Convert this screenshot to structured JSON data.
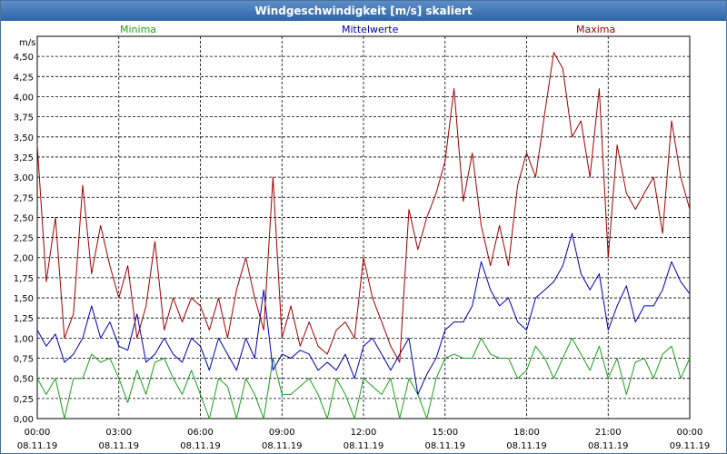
{
  "window": {
    "title": "Windgeschwindigkeit [m/s] skaliert"
  },
  "colors": {
    "min": "#1e9e1e",
    "mean": "#0000b4",
    "max": "#a00000",
    "grid": "#000000"
  },
  "chart_data": {
    "type": "line",
    "title": "Windgeschwindigkeit [m/s] skaliert",
    "ylabel": "m/s",
    "ylim": [
      0,
      4.75
    ],
    "yticks": [
      "0,00",
      "0,25",
      "0,50",
      "0,75",
      "1,00",
      "1,25",
      "1,50",
      "1,75",
      "2,00",
      "2,25",
      "2,50",
      "2,75",
      "3,00",
      "3,25",
      "3,50",
      "3,75",
      "4,00",
      "4,25",
      "4,50"
    ],
    "xlim_hours": [
      0,
      24
    ],
    "grid": true,
    "legend_position": "top",
    "xticks": [
      {
        "time": "00:00",
        "date": "08.11.19"
      },
      {
        "time": "03:00",
        "date": "08.11.19"
      },
      {
        "time": "06:00",
        "date": "08.11.19"
      },
      {
        "time": "09:00",
        "date": "08.11.19"
      },
      {
        "time": "12:00",
        "date": "08.11.19"
      },
      {
        "time": "15:00",
        "date": "08.11.19"
      },
      {
        "time": "18:00",
        "date": "08.11.19"
      },
      {
        "time": "21:00",
        "date": "08.11.19"
      },
      {
        "time": "00:00",
        "date": "09.11.19"
      }
    ],
    "series": [
      {
        "name": "Minima",
        "color": "#1e9e1e",
        "x": [
          0.0,
          0.33,
          0.67,
          1.0,
          1.33,
          1.67,
          2.0,
          2.33,
          2.67,
          3.0,
          3.33,
          3.67,
          4.0,
          4.33,
          4.67,
          5.0,
          5.33,
          5.67,
          6.0,
          6.33,
          6.67,
          7.0,
          7.33,
          7.67,
          8.0,
          8.33,
          8.67,
          9.0,
          9.33,
          9.67,
          10.0,
          10.33,
          10.67,
          11.0,
          11.33,
          11.67,
          12.0,
          12.33,
          12.67,
          13.0,
          13.33,
          13.67,
          14.0,
          14.33,
          14.67,
          15.0,
          15.33,
          15.67,
          16.0,
          16.33,
          16.67,
          17.0,
          17.33,
          17.67,
          18.0,
          18.33,
          18.67,
          19.0,
          19.33,
          19.67,
          20.0,
          20.33,
          20.67,
          21.0,
          21.33,
          21.67,
          22.0,
          22.33,
          22.67,
          23.0,
          23.33,
          23.67,
          24.0
        ],
        "values": [
          0.5,
          0.3,
          0.5,
          0.0,
          0.5,
          0.5,
          0.8,
          0.7,
          0.75,
          0.5,
          0.2,
          0.6,
          0.3,
          0.7,
          0.75,
          0.5,
          0.3,
          0.6,
          0.3,
          0.0,
          0.5,
          0.4,
          0.0,
          0.5,
          0.3,
          0.0,
          0.75,
          0.3,
          0.3,
          0.4,
          0.5,
          0.3,
          0.0,
          0.5,
          0.3,
          0.0,
          0.5,
          0.4,
          0.3,
          0.5,
          0.0,
          0.5,
          0.3,
          0.0,
          0.5,
          0.75,
          0.8,
          0.75,
          0.75,
          1.0,
          0.8,
          0.75,
          0.75,
          0.5,
          0.6,
          0.9,
          0.75,
          0.5,
          0.75,
          1.0,
          0.8,
          0.6,
          0.9,
          0.5,
          0.75,
          0.3,
          0.7,
          0.75,
          0.5,
          0.8,
          0.9,
          0.5,
          0.75
        ]
      },
      {
        "name": "Mittelwerte",
        "color": "#0000b4",
        "x": [
          0.0,
          0.33,
          0.67,
          1.0,
          1.33,
          1.67,
          2.0,
          2.33,
          2.67,
          3.0,
          3.33,
          3.67,
          4.0,
          4.33,
          4.67,
          5.0,
          5.33,
          5.67,
          6.0,
          6.33,
          6.67,
          7.0,
          7.33,
          7.67,
          8.0,
          8.33,
          8.67,
          9.0,
          9.33,
          9.67,
          10.0,
          10.33,
          10.67,
          11.0,
          11.33,
          11.67,
          12.0,
          12.33,
          12.67,
          13.0,
          13.33,
          13.67,
          14.0,
          14.33,
          14.67,
          15.0,
          15.33,
          15.67,
          16.0,
          16.33,
          16.67,
          17.0,
          17.33,
          17.67,
          18.0,
          18.33,
          18.67,
          19.0,
          19.33,
          19.67,
          20.0,
          20.33,
          20.67,
          21.0,
          21.33,
          21.67,
          22.0,
          22.33,
          22.67,
          23.0,
          23.33,
          23.67,
          24.0
        ],
        "values": [
          1.1,
          0.9,
          1.05,
          0.7,
          0.8,
          1.0,
          1.4,
          1.0,
          1.2,
          0.9,
          0.85,
          1.3,
          0.7,
          0.8,
          1.0,
          0.8,
          0.7,
          1.0,
          0.9,
          0.6,
          1.0,
          0.8,
          0.6,
          1.0,
          0.75,
          1.6,
          0.6,
          0.8,
          0.75,
          0.85,
          0.8,
          0.6,
          0.7,
          0.6,
          0.8,
          0.5,
          0.9,
          1.0,
          0.8,
          0.6,
          0.8,
          1.0,
          0.3,
          0.55,
          0.75,
          1.1,
          1.2,
          1.2,
          1.4,
          1.95,
          1.6,
          1.4,
          1.5,
          1.2,
          1.1,
          1.5,
          1.6,
          1.7,
          1.9,
          2.3,
          1.8,
          1.6,
          1.8,
          1.1,
          1.4,
          1.65,
          1.2,
          1.4,
          1.4,
          1.6,
          1.95,
          1.7,
          1.55
        ]
      },
      {
        "name": "Maxima",
        "color": "#a00000",
        "x": [
          0.0,
          0.33,
          0.67,
          1.0,
          1.33,
          1.67,
          2.0,
          2.33,
          2.67,
          3.0,
          3.33,
          3.67,
          4.0,
          4.33,
          4.67,
          5.0,
          5.33,
          5.67,
          6.0,
          6.33,
          6.67,
          7.0,
          7.33,
          7.67,
          8.0,
          8.33,
          8.67,
          9.0,
          9.33,
          9.67,
          10.0,
          10.33,
          10.67,
          11.0,
          11.33,
          11.67,
          12.0,
          12.33,
          12.67,
          13.0,
          13.33,
          13.67,
          14.0,
          14.33,
          14.67,
          15.0,
          15.33,
          15.67,
          16.0,
          16.33,
          16.67,
          17.0,
          17.33,
          17.67,
          18.0,
          18.33,
          18.67,
          19.0,
          19.33,
          19.67,
          20.0,
          20.33,
          20.67,
          21.0,
          21.33,
          21.67,
          22.0,
          22.33,
          22.67,
          23.0,
          23.33,
          23.67,
          24.0
        ],
        "values": [
          3.4,
          1.7,
          2.5,
          1.0,
          1.3,
          2.9,
          1.8,
          2.4,
          1.9,
          1.5,
          1.9,
          1.0,
          1.4,
          2.2,
          1.1,
          1.5,
          1.2,
          1.5,
          1.4,
          1.1,
          1.5,
          1.0,
          1.6,
          2.0,
          1.5,
          1.1,
          3.0,
          1.0,
          1.4,
          0.9,
          1.2,
          0.9,
          0.8,
          1.1,
          1.2,
          1.0,
          2.0,
          1.5,
          1.2,
          0.9,
          0.7,
          2.6,
          2.1,
          2.5,
          2.8,
          3.2,
          4.1,
          2.7,
          3.3,
          2.4,
          1.9,
          2.4,
          1.9,
          2.9,
          3.3,
          3.0,
          3.8,
          4.55,
          4.35,
          3.5,
          3.7,
          3.0,
          4.1,
          2.0,
          3.4,
          2.8,
          2.6,
          2.8,
          3.0,
          2.3,
          3.7,
          3.0,
          2.6
        ]
      }
    ]
  }
}
